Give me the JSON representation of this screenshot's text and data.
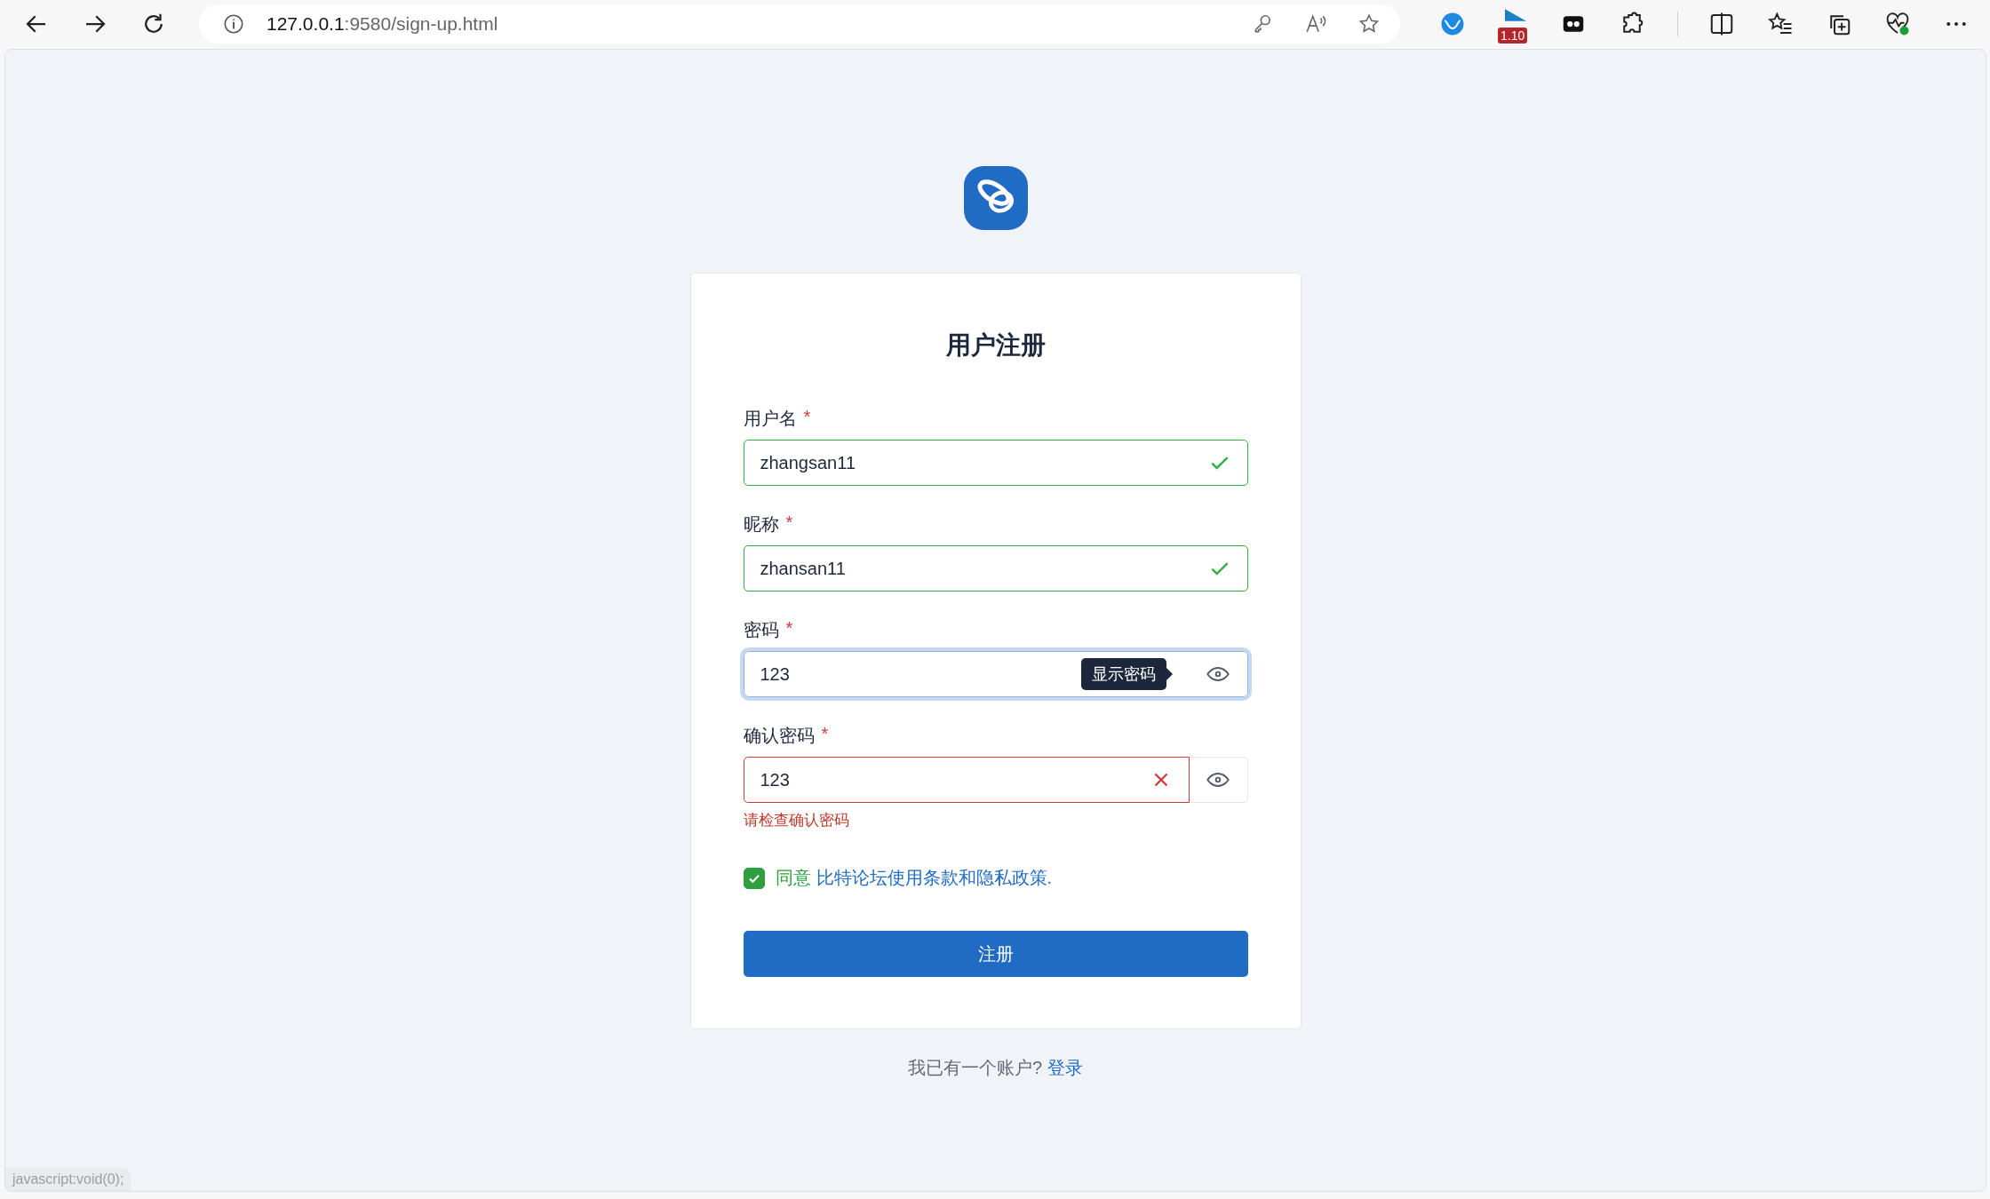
{
  "browser": {
    "url_host": "127.0.0.1",
    "url_rest": ":9580/sign-up.html",
    "extension_badge": "1.10"
  },
  "form": {
    "title": "用户注册",
    "fields": [
      {
        "label": "用户名",
        "required_mark": "*",
        "value": "zhangsan11",
        "valid": true,
        "invalid": false,
        "focused": false,
        "toggle": false
      },
      {
        "label": "昵称",
        "required_mark": "*",
        "value": "zhansan11",
        "valid": true,
        "invalid": false,
        "focused": false,
        "toggle": false
      },
      {
        "label": "密码",
        "required_mark": "*",
        "value": "123",
        "valid": false,
        "invalid": false,
        "focused": true,
        "toggle": true,
        "tooltip": "显示密码"
      },
      {
        "label": "确认密码",
        "required_mark": "*",
        "value": "123",
        "valid": false,
        "invalid": true,
        "focused": false,
        "toggle": true,
        "error": "请检查确认密码"
      }
    ],
    "agreement": {
      "checked": true,
      "text": "同意",
      "link": "比特论坛使用条款和隐私政策."
    },
    "submit": "注册"
  },
  "footer": {
    "text": "我已有一个账户?",
    "link": "登录"
  },
  "status_bar": "javascript:void(0);"
}
